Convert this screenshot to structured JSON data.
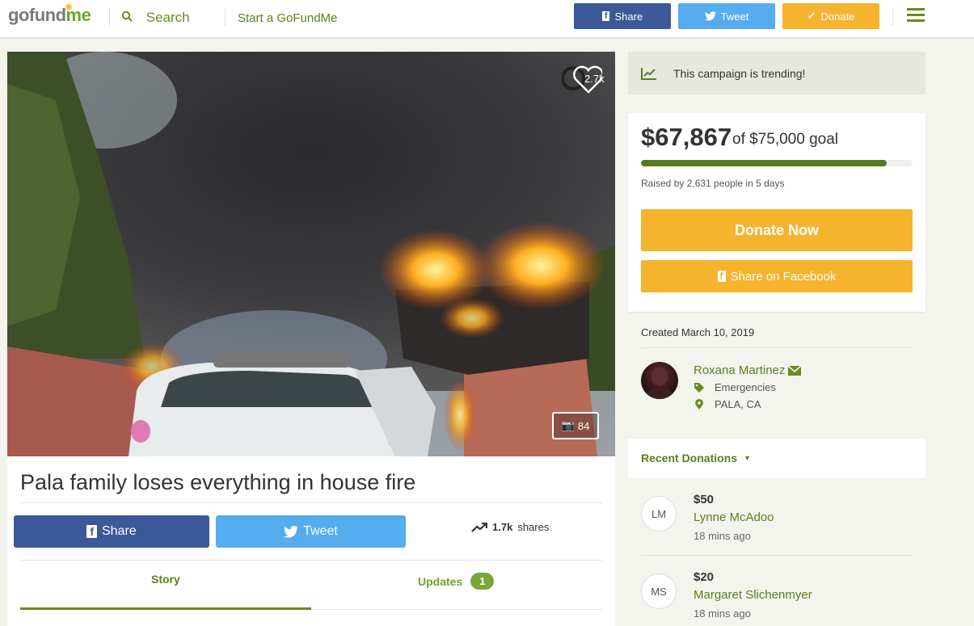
{
  "header": {
    "logo_go": "go",
    "logo_fund": "fund",
    "logo_me": "me",
    "search_label": "Search",
    "start_label": "Start a GoFundMe",
    "share_label": "Share",
    "tweet_label": "Tweet",
    "donate_label": "Donate"
  },
  "hero": {
    "heart_count": "2.7k",
    "photo_count": "84"
  },
  "campaign": {
    "title": "Pala family loses everything in house fire",
    "share_label": "Share",
    "tweet_label": "Tweet",
    "shares_count": "1.7k",
    "shares_label": "shares",
    "tabs": [
      {
        "label": "Story"
      },
      {
        "label": "Updates",
        "badge": "1"
      }
    ]
  },
  "sidebar": {
    "trending": "This campaign is trending!",
    "raised": "$67,867",
    "goal": "of $75,000 goal",
    "progress_fraction": 0.905,
    "raised_by": "Raised by 2,631 people in 5 days",
    "donate_now": "Donate Now",
    "share_facebook": "Share on Facebook",
    "created": "Created March 10, 2019",
    "organizer": {
      "name": "Roxana Martinez",
      "category": "Emergencies",
      "location": "PALA, CA"
    },
    "recent_donations_label": "Recent Donations",
    "donations": [
      {
        "initials": "LM",
        "amount": "$50",
        "name": "Lynne McAdoo",
        "time": "18 mins ago"
      },
      {
        "initials": "MS",
        "amount": "$20",
        "name": "Margaret Slichenmyer",
        "time": "18 mins ago"
      }
    ]
  },
  "colors": {
    "brand_green": "#5e7d1c",
    "donate_orange": "#f5b32e",
    "facebook_blue": "#3b5998",
    "twitter_blue": "#55acee"
  }
}
